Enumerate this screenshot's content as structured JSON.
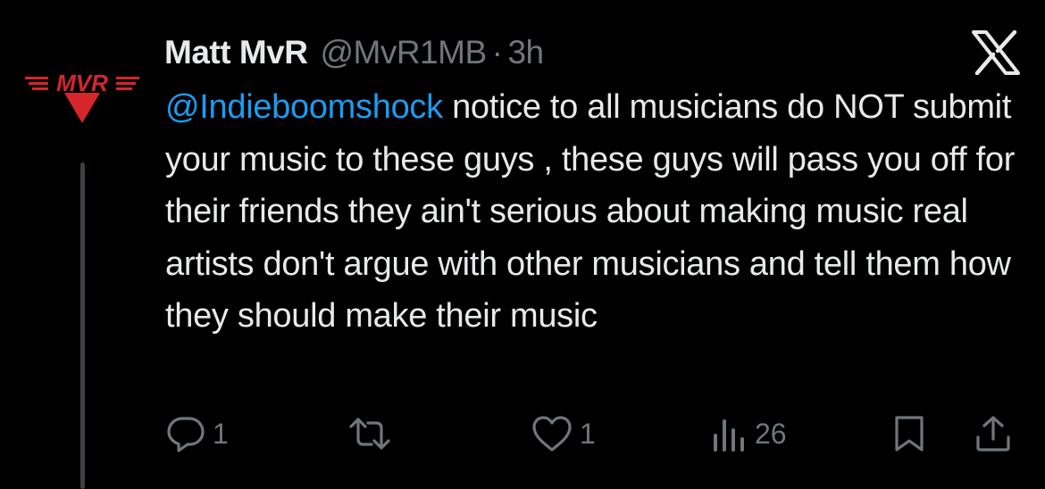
{
  "tweet": {
    "display_name": "Matt MvR",
    "handle": "@MvR1MB",
    "separator": "·",
    "time": "3h",
    "mention": "@Indieboomshock",
    "body": " notice to all musicians do NOT submit your music to these guys , these guys will pass you off for their friends they ain't serious about making music real artists don't argue with other musicians and tell them how they should make their music"
  },
  "avatar": {
    "logo_text": "MVR",
    "accent_color": "#d4262b"
  },
  "actions": {
    "reply_count": "1",
    "retweet_count": "",
    "like_count": "1",
    "view_count": "26"
  },
  "icons": {
    "platform": "x-logo-icon",
    "reply": "reply-icon",
    "retweet": "retweet-icon",
    "like": "heart-icon",
    "views": "views-icon",
    "bookmark": "bookmark-icon",
    "share": "share-icon"
  },
  "colors": {
    "background": "#000000",
    "text": "#e7e9ea",
    "muted": "#71767b",
    "link": "#1d9bf0"
  }
}
